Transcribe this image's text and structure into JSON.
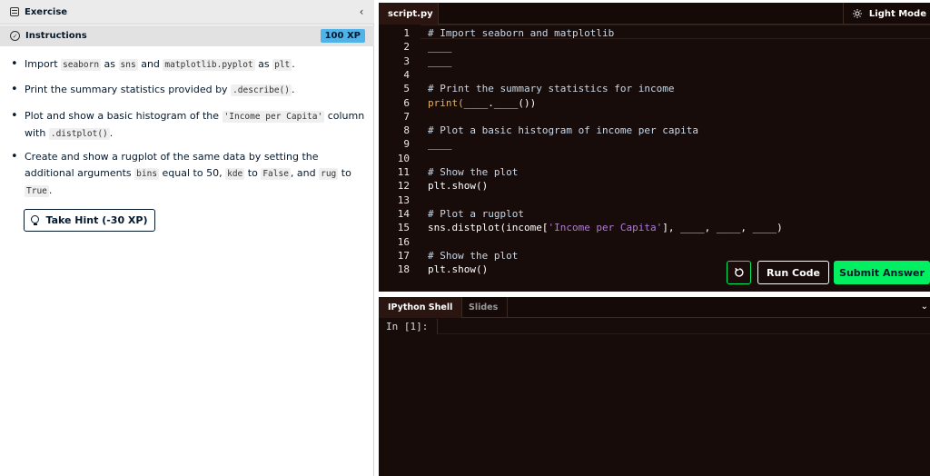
{
  "exercise": {
    "title": "Exercise",
    "collapse_glyph": "‹"
  },
  "instructions": {
    "title": "Instructions",
    "xp": "100 XP",
    "bullets": [
      {
        "parts": [
          {
            "t": "Import "
          },
          {
            "c": "seaborn"
          },
          {
            "t": " as "
          },
          {
            "c": "sns"
          },
          {
            "t": " and "
          },
          {
            "c": "matplotlib.pyplot"
          },
          {
            "t": " as "
          },
          {
            "c": "plt"
          },
          {
            "t": "."
          }
        ]
      },
      {
        "parts": [
          {
            "t": "Print the summary statistics provided by "
          },
          {
            "c": ".describe()"
          },
          {
            "t": "."
          }
        ]
      },
      {
        "parts": [
          {
            "t": "Plot and show a basic histogram of the "
          },
          {
            "c": "'Income per Capita'"
          },
          {
            "t": " column with "
          },
          {
            "c": ".distplot()"
          },
          {
            "t": "."
          }
        ]
      },
      {
        "parts": [
          {
            "t": "Create and show a rugplot of the same data by setting the additional arguments "
          },
          {
            "c": "bins"
          },
          {
            "t": " equal to 50, "
          },
          {
            "c": "kde"
          },
          {
            "t": " to "
          },
          {
            "c": "False"
          },
          {
            "t": ", and "
          },
          {
            "c": "rug"
          },
          {
            "t": " to "
          },
          {
            "c": "True"
          },
          {
            "t": "."
          }
        ]
      }
    ],
    "hint_button": "Take Hint (-30 XP)"
  },
  "editor": {
    "tab": "script.py",
    "light_mode": "Light Mode",
    "lines": [
      {
        "n": "1",
        "seg": [
          {
            "k": "com",
            "t": "# Import seaborn and matplotlib"
          }
        ]
      },
      {
        "n": "2",
        "seg": [
          {
            "k": "blank",
            "t": "____"
          }
        ]
      },
      {
        "n": "3",
        "seg": [
          {
            "k": "blank",
            "t": "____"
          }
        ]
      },
      {
        "n": "4",
        "seg": []
      },
      {
        "n": "5",
        "seg": [
          {
            "k": "com",
            "t": "# Print the summary statistics for income"
          }
        ]
      },
      {
        "n": "6",
        "seg": [
          {
            "k": "kw",
            "t": "print("
          },
          {
            "k": "blank",
            "t": "____.____"
          },
          {
            "k": "plain",
            "t": "())"
          }
        ]
      },
      {
        "n": "7",
        "seg": []
      },
      {
        "n": "8",
        "seg": [
          {
            "k": "com",
            "t": "# Plot a basic histogram of income per capita"
          }
        ]
      },
      {
        "n": "9",
        "seg": [
          {
            "k": "blank",
            "t": "____"
          }
        ]
      },
      {
        "n": "10",
        "seg": []
      },
      {
        "n": "11",
        "seg": [
          {
            "k": "com",
            "t": "# Show the plot"
          }
        ]
      },
      {
        "n": "12",
        "seg": [
          {
            "k": "plain",
            "t": "plt.show()"
          }
        ]
      },
      {
        "n": "13",
        "seg": []
      },
      {
        "n": "14",
        "seg": [
          {
            "k": "com",
            "t": "# Plot a rugplot"
          }
        ]
      },
      {
        "n": "15",
        "seg": [
          {
            "k": "plain",
            "t": "sns.distplot(income["
          },
          {
            "k": "str",
            "t": "'Income per Capita'"
          },
          {
            "k": "plain",
            "t": "], ____, ____, ____)"
          }
        ]
      },
      {
        "n": "16",
        "seg": []
      },
      {
        "n": "17",
        "seg": [
          {
            "k": "com",
            "t": "# Show the plot"
          }
        ]
      },
      {
        "n": "18",
        "seg": [
          {
            "k": "plain",
            "t": "plt.show()"
          }
        ]
      }
    ],
    "run_button": "Run Code",
    "submit_button": "Submit Answer"
  },
  "shell": {
    "tab_active": "IPython Shell",
    "tab_inactive": "Slides",
    "prompt": "In [1]:",
    "chevron": "⌄"
  },
  "colors": {
    "accent_green": "#03ef62",
    "xp_blue": "#4fb3e8",
    "editor_bg": "#180c0a"
  }
}
